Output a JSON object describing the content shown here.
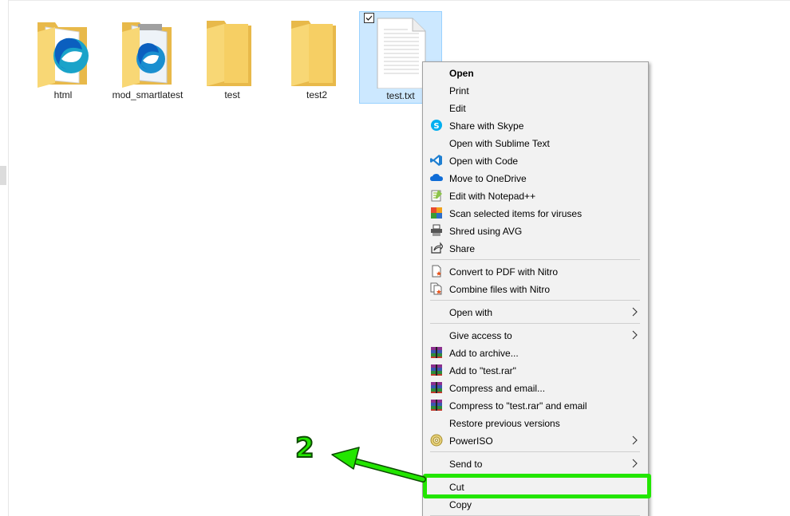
{
  "files": [
    {
      "name": "html",
      "type": "folder-edge"
    },
    {
      "name": "mod_smartlatest",
      "type": "folder-notepad"
    },
    {
      "name": "test",
      "type": "folder"
    },
    {
      "name": "test2",
      "type": "folder"
    },
    {
      "name": "test.txt",
      "type": "text-file",
      "selected": true
    }
  ],
  "context_menu": {
    "items": [
      {
        "label": "Open",
        "icon": "none",
        "bold": true
      },
      {
        "label": "Print",
        "icon": "none"
      },
      {
        "label": "Edit",
        "icon": "none"
      },
      {
        "label": "Share with Skype",
        "icon": "skype-icon"
      },
      {
        "label": "Open with Sublime Text",
        "icon": "none"
      },
      {
        "label": "Open with Code",
        "icon": "vscode-icon"
      },
      {
        "label": "Move to OneDrive",
        "icon": "onedrive-icon"
      },
      {
        "label": "Edit with Notepad++",
        "icon": "notepadpp-icon"
      },
      {
        "label": "Scan selected items for viruses",
        "icon": "antivirus-icon"
      },
      {
        "label": "Shred using AVG",
        "icon": "shredder-icon"
      },
      {
        "label": "Share",
        "icon": "share-icon"
      },
      {
        "label": "Convert to PDF with Nitro",
        "icon": "nitro-convert-icon"
      },
      {
        "label": "Combine files with Nitro",
        "icon": "nitro-combine-icon"
      },
      {
        "label": "Open with",
        "icon": "none",
        "submenu": true
      },
      {
        "label": "Give access to",
        "icon": "none",
        "submenu": true
      },
      {
        "label": "Add to archive...",
        "icon": "winrar-icon"
      },
      {
        "label": "Add to \"test.rar\"",
        "icon": "winrar-icon"
      },
      {
        "label": "Compress and email...",
        "icon": "winrar-icon"
      },
      {
        "label": "Compress to \"test.rar\" and email",
        "icon": "winrar-icon"
      },
      {
        "label": "Restore previous versions",
        "icon": "none"
      },
      {
        "label": "PowerISO",
        "icon": "poweriso-icon",
        "submenu": true
      },
      {
        "label": "Send to",
        "icon": "none",
        "submenu": true
      },
      {
        "label": "Cut",
        "icon": "none",
        "highlighted": true
      },
      {
        "label": "Copy",
        "icon": "none"
      }
    ]
  },
  "annotation": {
    "step_number": "2",
    "color": "#23e600"
  }
}
